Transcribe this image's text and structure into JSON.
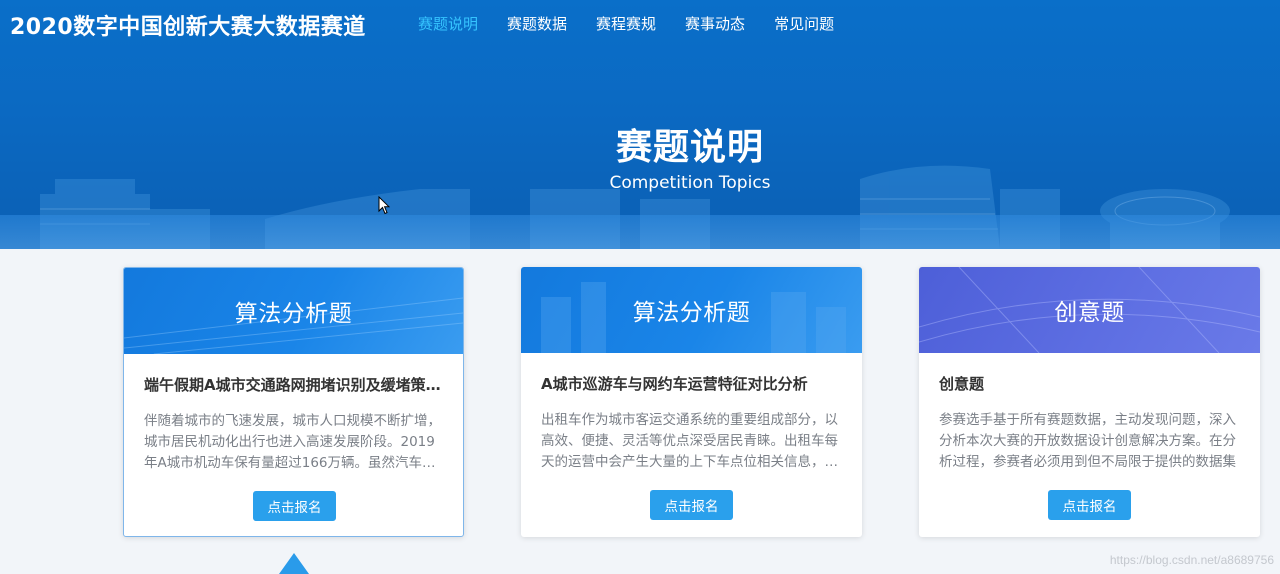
{
  "header": {
    "site_title": "2020数字中国创新大赛大数据赛道",
    "nav": [
      {
        "label": "赛题说明",
        "active": true
      },
      {
        "label": "赛题数据",
        "active": false
      },
      {
        "label": "赛程赛规",
        "active": false
      },
      {
        "label": "赛事动态",
        "active": false
      },
      {
        "label": "常见问题",
        "active": false
      }
    ]
  },
  "hero": {
    "title": "赛题说明",
    "subtitle": "Competition Topics"
  },
  "cards": [
    {
      "banner": "算法分析题",
      "title": "端午假期A城市交通路网拥堵识别及缓堵策略研究",
      "description": "伴随着城市的飞速发展，城市人口规模不断扩增，城市居民机动化出行也进入高速发展阶段。2019年A城市机动车保有量超过166万辆。虽然汽车数量的增加方便了居民出行",
      "button": "点击报名"
    },
    {
      "banner": "算法分析题",
      "title": "A城市巡游车与网约车运营特征对比分析",
      "description": "出租车作为城市客运交通系统的重要组成部分，以高效、便捷、灵活等优点深受居民青睐。出租车每天的运营中会产生大量的上下车点位相关信息，反映了城市居民出行规律",
      "button": "点击报名"
    },
    {
      "banner": "创意题",
      "title": "创意题",
      "description": "参赛选手基于所有赛题数据，主动发现问题，深入分析本次大赛的开放数据设计创意解决方案。在分析过程，参赛者必须用到但不局限于提供的数据集",
      "button": "点击报名"
    }
  ],
  "watermark": "https://blog.csdn.net/a8689756",
  "colors": {
    "hero_blue": "#0b69c2",
    "nav_active": "#35c4ff",
    "button": "#2aa0ec",
    "banner_purple": "#5d6ee2"
  }
}
